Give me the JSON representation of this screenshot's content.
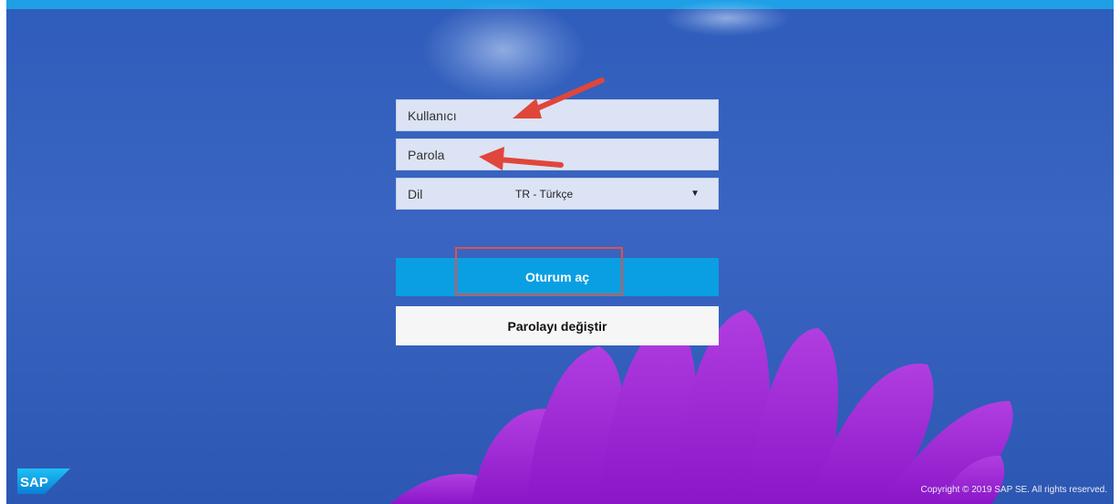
{
  "login": {
    "username_placeholder": "Kullanıcı",
    "password_placeholder": "Parola",
    "language_label": "Dil",
    "language_value": "TR - Türkçe",
    "login_button": "Oturum aç",
    "change_password_button": "Parolayı değiştir"
  },
  "footer": {
    "logo_text": "SAP",
    "copyright": "Copyright © 2019 SAP SE. All rights reserved."
  },
  "colors": {
    "topbar": "#1fa0e6",
    "primary_button": "#0a9fe2",
    "annotation": "#e0463a",
    "background": "#2f5dbb"
  },
  "icons": {
    "dropdown": "caret-down-icon",
    "annotation": "arrow-icon"
  }
}
